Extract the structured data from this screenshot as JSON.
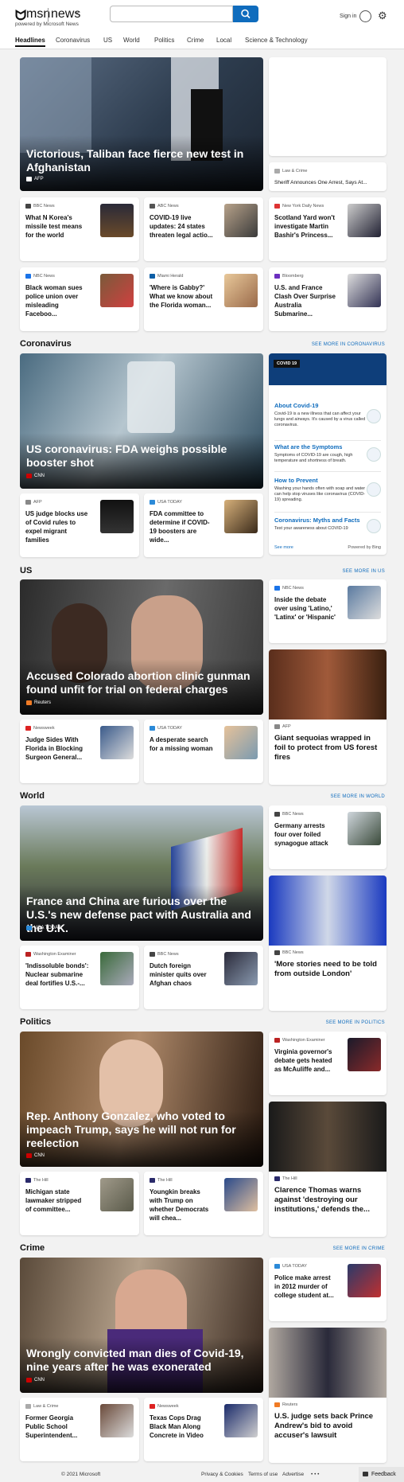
{
  "header": {
    "brand": "msn",
    "section": "news",
    "powered": "powered by Microsoft News",
    "search_placeholder": "",
    "sign_in": "Sign in",
    "brand_icon": "butterfly-icon"
  },
  "nav": [
    "Headlines",
    "Coronavirus",
    "US",
    "World",
    "Politics",
    "Crime",
    "Local",
    "Science & Technology"
  ],
  "headlines": {
    "hero": {
      "title": "Victorious, Taliban face fierce new test in Afghanistan",
      "source": "AFP"
    },
    "side_card": {
      "source": "Law & Crime",
      "title": "Sheriff Announces One Arrest, Says At..."
    },
    "cards": [
      {
        "source": "BBC News",
        "title": "What N Korea's missile test means for the world"
      },
      {
        "source": "ABC News",
        "title": "COVID-19 live updates: 24 states threaten legal actio..."
      },
      {
        "source": "New York Daily News",
        "title": "Scotland Yard won't investigate Martin Bashir's Princess..."
      },
      {
        "source": "NBC News",
        "title": "Black woman sues police union over misleading Faceboo..."
      },
      {
        "source": "Miami Herald",
        "title": "'Where is Gabby?' What we know about the Florida woman..."
      },
      {
        "source": "Bloomberg",
        "title": "U.S. and France Clash Over Surprise Australia Submarine..."
      }
    ]
  },
  "coronavirus": {
    "label": "Coronavirus",
    "more": "SEE MORE IN CORONAVIRUS",
    "hero": {
      "title": "US coronavirus: FDA weighs possible booster shot",
      "source": "CNN"
    },
    "cards": [
      {
        "source": "AFP",
        "title": "US judge blocks use of Covid rules to expel migrant families"
      },
      {
        "source": "USA TODAY",
        "title": "FDA committee to determine if COVID-19 boosters are wide..."
      }
    ],
    "covid": {
      "tag": "COVID 19",
      "items": [
        {
          "h": "About Covid-19",
          "d": "Covid-19 is a new illness that can affect your lungs and airways. It's caused by a virus called coronavirus."
        },
        {
          "h": "What are the Symptoms",
          "d": "Symptoms of COVID-19 are cough, high temperature and shortness of breath."
        },
        {
          "h": "How to Prevent",
          "d": "Washing your hands often with soap and water can help stop viruses like coronavirus (COVID-19) spreading."
        },
        {
          "h": "Coronavirus: Myths and Facts",
          "d": "Test your awareness about COVID-19"
        }
      ],
      "see_more": "See more",
      "powered": "Powered by Bing"
    }
  },
  "us": {
    "label": "US",
    "more": "SEE MORE IN US",
    "hero": {
      "title": "Accused Colorado abortion clinic gunman found unfit for trial on federal charges",
      "source": "Reuters"
    },
    "side_card": {
      "source": "NBC News",
      "title": "Inside the debate over using 'Latino,' 'Latinx' or 'Hispanic'"
    },
    "photo_card": {
      "source": "AFP",
      "title": "Giant sequoias wrapped in foil to protect from US forest fires"
    },
    "cards": [
      {
        "source": "Newsweek",
        "title": "Judge Sides With Florida in Blocking Surgeon General..."
      },
      {
        "source": "USA TODAY",
        "title": "A desperate search for a missing woman"
      }
    ]
  },
  "world": {
    "label": "World",
    "more": "SEE MORE IN WORLD",
    "hero": {
      "title": "France and China are furious over the U.S.'s new defense pact with Australia and the U.K.",
      "source": "USA TODAY"
    },
    "side_card": {
      "source": "BBC News",
      "title": "Germany arrests four over foiled synagogue attack"
    },
    "photo_card": {
      "source": "BBC News",
      "title": "'More stories need to be told from outside London'"
    },
    "cards": [
      {
        "source": "Washington Examiner",
        "title": "'Indissoluble bonds': Nuclear submarine deal fortifies U.S.-..."
      },
      {
        "source": "BBC News",
        "title": "Dutch foreign minister quits over Afghan chaos"
      }
    ]
  },
  "politics": {
    "label": "Politics",
    "more": "SEE MORE IN POLITICS",
    "hero": {
      "title": "Rep. Anthony Gonzalez, who voted to impeach Trump, says he will not run for reelection",
      "source": "CNN"
    },
    "side_card": {
      "source": "Washington Examiner",
      "title": "Virginia governor's debate gets heated as McAuliffe and..."
    },
    "photo_card": {
      "source": "The Hill",
      "title": "Clarence Thomas warns against 'destroying our institutions,' defends the..."
    },
    "cards": [
      {
        "source": "The Hill",
        "title": "Michigan state lawmaker stripped of committee..."
      },
      {
        "source": "The Hill",
        "title": "Youngkin breaks with Trump on whether Democrats will chea..."
      }
    ]
  },
  "crime": {
    "label": "Crime",
    "more": "SEE MORE IN CRIME",
    "hero": {
      "title": "Wrongly convicted man dies of Covid-19, nine years after he was exonerated",
      "source": "CNN"
    },
    "side_card": {
      "source": "USA TODAY",
      "title": "Police make arrest in 2012 murder of college student at..."
    },
    "photo_card": {
      "source": "Reuters",
      "title": "U.S. judge sets back Prince Andrew's bid to avoid accuser's lawsuit"
    },
    "cards": [
      {
        "source": "Law & Crime",
        "title": "Former Georgia Public School Superintendent..."
      },
      {
        "source": "Newsweek",
        "title": "Texas Cops Drag Black Man Along Concrete in Video"
      }
    ]
  },
  "footer": {
    "copyright": "© 2021 Microsoft",
    "privacy": "Privacy & Cookies",
    "terms": "Terms of use",
    "advertise": "Advertise",
    "more": "• • •",
    "feedback": "Feedback"
  }
}
